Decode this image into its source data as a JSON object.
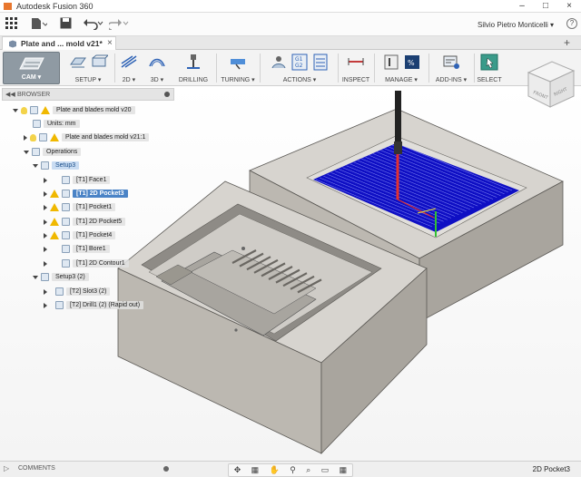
{
  "window": {
    "title": "Autodesk Fusion 360",
    "user": "Silvio Pietro Monticelli ▾",
    "help": "?"
  },
  "qat": {
    "grid_icon": "grid-icon",
    "file_icon": "file-icon",
    "save_icon": "save-icon",
    "undo_icon": "undo-icon",
    "redo_icon": "redo-icon"
  },
  "tab": {
    "label": "Plate and ... mold v21*",
    "close": "×",
    "add": "+"
  },
  "ribbon": {
    "workspace": "CAM ▾",
    "groups": [
      "SETUP ▾",
      "2D ▾",
      "3D ▾",
      "DRILLING",
      "TURNING ▾",
      "ACTIONS ▾",
      "INSPECT",
      "MANAGE ▾",
      "ADD-INS ▾",
      "SELECT"
    ]
  },
  "browser": {
    "title": "BROWSER",
    "root": "Plate and blades mold v20",
    "units": "Units: mm",
    "component": "Plate and blades mold v21:1",
    "operations": "Operations",
    "setup1": "Setup3",
    "ops1": [
      "[T1] Face1",
      "[T1] 2D Pocket3",
      "[T1] Pocket1",
      "[T1] 2D Pocket5",
      "[T1] Pocket4",
      "[T1] Bore1",
      "[T1] 2D Contour1"
    ],
    "setup2": "Setup3 (2)",
    "ops2": [
      "[T2] Slot3 (2)",
      "[T2] Drill1 (2) (Rapid out)"
    ]
  },
  "viewcube": {
    "front": "FRONT",
    "right": "RIGHT"
  },
  "status": {
    "comments": "COMMENTS",
    "selection": "2D Pocket3"
  },
  "colors": {
    "accent": "#4a83c6",
    "toolpath": "#1a1ad8",
    "warning": "#f0b800"
  }
}
